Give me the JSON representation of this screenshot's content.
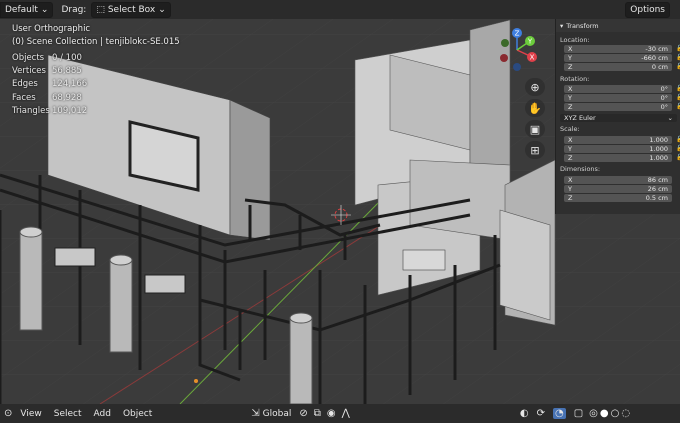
{
  "header": {
    "mode": "Default",
    "drag_label": "Drag:",
    "select_box": "Select Box",
    "options": "Options"
  },
  "viewport": {
    "view_name": "User Orthographic",
    "collection": "(0) Scene Collection | tenjiblokc-SE.015",
    "stats": [
      {
        "k": "Objects",
        "v": "0 / 100"
      },
      {
        "k": "Vertices",
        "v": "56,885"
      },
      {
        "k": "Edges",
        "v": "124,166"
      },
      {
        "k": "Faces",
        "v": "68,928"
      },
      {
        "k": "Triangles",
        "v": "109,012"
      }
    ]
  },
  "gizmo": {
    "z": "Z",
    "x": "X",
    "y": "Y"
  },
  "transform": {
    "title": "Transform",
    "location_label": "Location:",
    "location": [
      {
        "a": "X",
        "v": "-30 cm"
      },
      {
        "a": "Y",
        "v": "-660 cm"
      },
      {
        "a": "Z",
        "v": "0 cm"
      }
    ],
    "rotation_label": "Rotation:",
    "rotation": [
      {
        "a": "X",
        "v": "0°"
      },
      {
        "a": "Y",
        "v": "0°"
      },
      {
        "a": "Z",
        "v": "0°"
      }
    ],
    "rotation_mode": "XYZ Euler",
    "scale_label": "Scale:",
    "scale": [
      {
        "a": "X",
        "v": "1.000"
      },
      {
        "a": "Y",
        "v": "1.000"
      },
      {
        "a": "Z",
        "v": "1.000"
      }
    ],
    "dimensions_label": "Dimensions:",
    "dimensions": [
      {
        "a": "X",
        "v": "86 cm"
      },
      {
        "a": "Y",
        "v": "26 cm"
      },
      {
        "a": "Z",
        "v": "0.5 cm"
      }
    ]
  },
  "footer": {
    "view": "View",
    "select": "Select",
    "add": "Add",
    "object": "Object",
    "orientation": "Global"
  },
  "colors": {
    "accent": "#4772b3",
    "axis_x": "#e0404a",
    "axis_y": "#6ccc3c",
    "axis_z": "#3f7fe0"
  }
}
